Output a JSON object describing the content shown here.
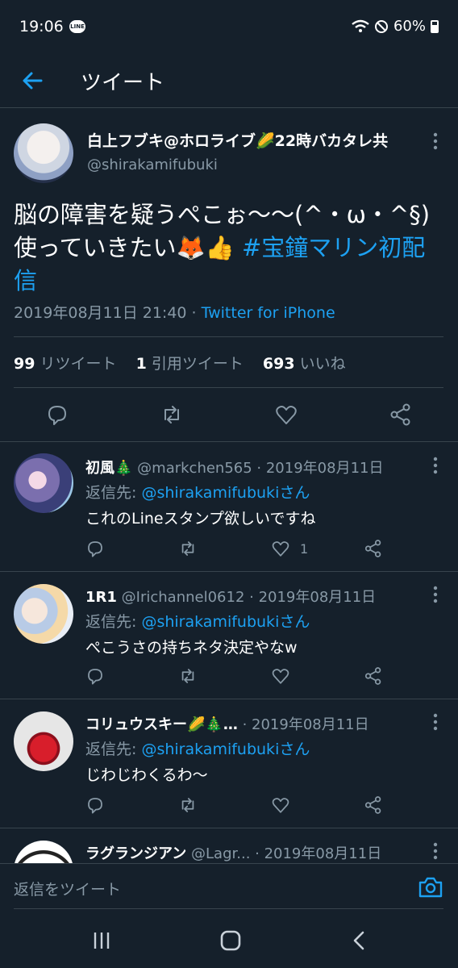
{
  "status_bar": {
    "time": "19:06",
    "line_badge": "LINE",
    "battery": "60%"
  },
  "header": {
    "title": "ツイート"
  },
  "main_tweet": {
    "name": "白上フブキ@ホロライブ🌽22時バカタレ共",
    "handle": "@shirakamifubuki",
    "text_line1": "脳の障害を疑うぺこぉ〜〜(^・ω・^§)",
    "text_line2_prefix": "使っていきたい🦊👍 ",
    "hashtag_part1": "#宝鐘マリン初配",
    "hashtag_part2": "信",
    "timestamp": "2019年08月11日 21:40",
    "separator": " · ",
    "source": "Twitter for iPhone",
    "retweets_count": "99",
    "retweets_label": "リツイート",
    "quotes_count": "1",
    "quotes_label": "引用ツイート",
    "likes_count": "693",
    "likes_label": "いいね"
  },
  "replies": [
    {
      "name": "初風🎄",
      "handle": "@markchen565 · 2019年08月11日",
      "reply_to_label": "返信先: ",
      "reply_to_mention": "@shirakamifubukiさん",
      "text": "これのLineスタンプ欲しいですね",
      "like_count": "1"
    },
    {
      "name": "1R1",
      "handle": "@Irichannel0612 · 2019年08月11日",
      "reply_to_label": "返信先: ",
      "reply_to_mention": "@shirakamifubukiさん",
      "text": "ぺこうさの持ちネタ決定やなw",
      "like_count": ""
    },
    {
      "name": "コリュウスキー🌽🎄…",
      "handle": " · 2019年08月11日",
      "reply_to_label": "返信先: ",
      "reply_to_mention": "@shirakamifubukiさん",
      "text": "じわじわくるわ〜",
      "like_count": ""
    },
    {
      "name": "ラグランジアン",
      "handle": "@Lagr... · 2019年08月11日"
    }
  ],
  "compose": {
    "placeholder": "返信をツイート"
  },
  "colors": {
    "background": "#15202b",
    "accent": "#1da1f2",
    "muted": "#8899a6",
    "divider": "#38444d"
  },
  "icons": {
    "back": "arrow-left-icon",
    "more": "more-vertical-icon",
    "reply": "reply-icon",
    "retweet": "retweet-icon",
    "like": "heart-icon",
    "share": "share-icon",
    "camera": "camera-icon",
    "nav_recents": "recents-icon",
    "nav_home": "home-icon",
    "nav_back": "back-chevron-icon"
  }
}
